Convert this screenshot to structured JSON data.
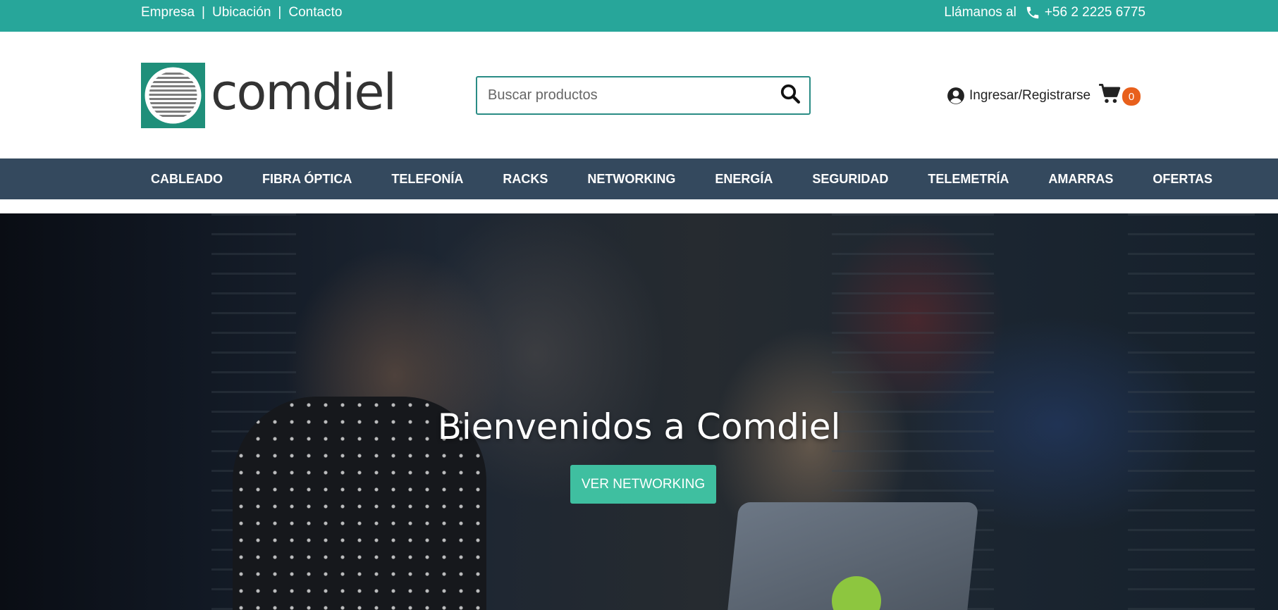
{
  "topbar": {
    "links": [
      "Empresa",
      "Ubicación",
      "Contacto"
    ],
    "separator": "|",
    "call_label": "Llámanos al",
    "phone": "+56 2 2225 6775",
    "phone_icon": "phone-icon"
  },
  "header": {
    "logo_text": "comdiel",
    "search": {
      "placeholder": "Buscar productos",
      "value": "",
      "icon": "search-icon"
    },
    "account_label": "Ingresar/Registrarse",
    "account_icon": "user-circle-icon",
    "cart_icon": "cart-icon",
    "cart_count": "0"
  },
  "nav": {
    "items": [
      "CABLEADO",
      "FIBRA ÓPTICA",
      "TELEFONÍA",
      "RACKS",
      "NETWORKING",
      "ENERGÍA",
      "SEGURIDAD",
      "TELEMETRÍA",
      "AMARRAS",
      "OFERTAS"
    ]
  },
  "hero": {
    "title": "Bienvenidos a Comdiel",
    "cta_label": "VER NETWORKING"
  },
  "colors": {
    "topbar": "#27a69a",
    "nav": "#34495e",
    "cta": "#3fbfa0",
    "badge": "#e8601c",
    "logo_green": "#1f8f7a"
  }
}
